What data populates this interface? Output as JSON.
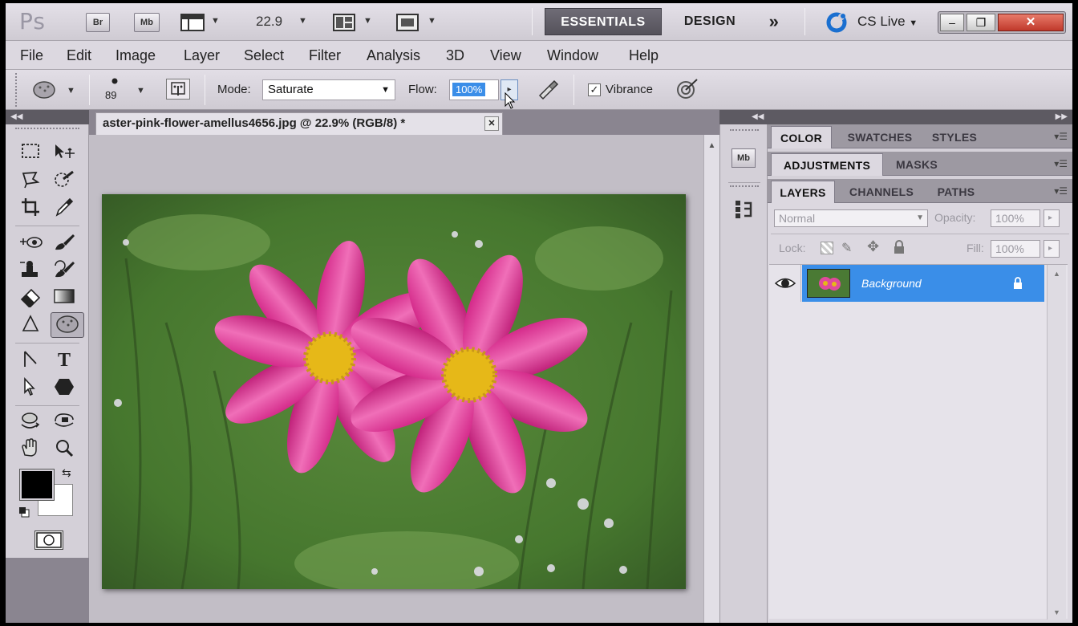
{
  "appbar": {
    "logo": "Ps",
    "bridge": "Br",
    "minibridge": "Mb",
    "zoom": "22.9",
    "workspaces": {
      "essentials": "ESSENTIALS",
      "design": "DESIGN",
      "more": "»"
    },
    "cslive": "CS Live",
    "window_controls": {
      "minimize": "–",
      "restore": "❐",
      "close": "✕"
    }
  },
  "menu": [
    "File",
    "Edit",
    "Image",
    "Layer",
    "Select",
    "Filter",
    "Analysis",
    "3D",
    "View",
    "Window",
    "Help"
  ],
  "options": {
    "brush_size": "89",
    "mode_label": "Mode:",
    "mode_value": "Saturate",
    "flow_label": "Flow:",
    "flow_value": "100%",
    "vibrance_label": "Vibrance",
    "vibrance_checked": true
  },
  "document": {
    "tab_title": "aster-pink-flower-amellus4656.jpg @ 22.9% (RGB/8) *",
    "close": "✕"
  },
  "tools": {
    "foreground_color": "#000000",
    "background_color": "#ffffff"
  },
  "panels": {
    "group1": [
      "COLOR",
      "SWATCHES",
      "STYLES"
    ],
    "group2": [
      "ADJUSTMENTS",
      "MASKS"
    ],
    "group3": [
      "LAYERS",
      "CHANNELS",
      "PATHS"
    ],
    "blend_mode": "Normal",
    "opacity_label": "Opacity:",
    "opacity_value": "100%",
    "lock_label": "Lock:",
    "fill_label": "Fill:",
    "fill_value": "100%",
    "layers": [
      {
        "name": "Background",
        "locked": true,
        "visible": true,
        "selected": true
      }
    ],
    "selected_color": "#3a8ee8"
  },
  "iconstrip": {
    "mb": "Mb"
  }
}
